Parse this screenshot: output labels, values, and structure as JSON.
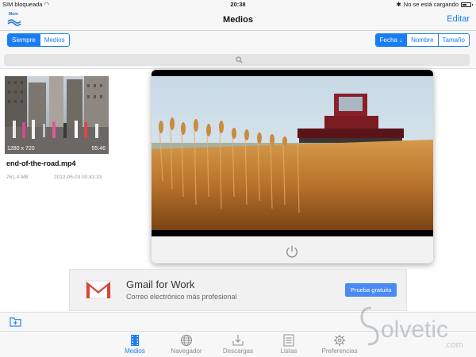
{
  "status_bar": {
    "carrier": "SIM bloqueada",
    "time": "20:38",
    "charging_text": "No se está cargando"
  },
  "nav": {
    "more_label": "More",
    "title": "Medios",
    "edit_label": "Editar"
  },
  "filter_left": [
    {
      "label": "Siempre",
      "active": true
    },
    {
      "label": "Medios",
      "active": false
    }
  ],
  "sort_right": [
    {
      "label": "Fecha ↓",
      "active": true
    },
    {
      "label": "Nombre",
      "active": false
    },
    {
      "label": "Tamaño",
      "active": false
    }
  ],
  "media_item": {
    "resolution": "1280 x 720",
    "duration": "55:46",
    "name": "end-of-the-road.mp4",
    "size": "761.4 MB",
    "date": "2012-06-03 00:43:33"
  },
  "ad": {
    "title": "Gmail for Work",
    "subtitle": "Correo electrónico más profesional",
    "cta": "Prueba gratuita"
  },
  "tabs": [
    {
      "label": "Medios",
      "icon": "film-icon",
      "active": true
    },
    {
      "label": "Navegador",
      "icon": "globe-icon",
      "active": false
    },
    {
      "label": "Descargas",
      "icon": "download-icon",
      "active": false
    },
    {
      "label": "Listas",
      "icon": "list-icon",
      "active": false
    },
    {
      "label": "Preferencias",
      "icon": "gear-icon",
      "active": false
    }
  ],
  "watermark": {
    "text": "olvetic",
    "domain": ".com"
  },
  "colors": {
    "accent": "#1a7cf4",
    "ad_button": "#4a8af4",
    "gmail_red": "#db4437"
  },
  "battery_level": 0.5
}
